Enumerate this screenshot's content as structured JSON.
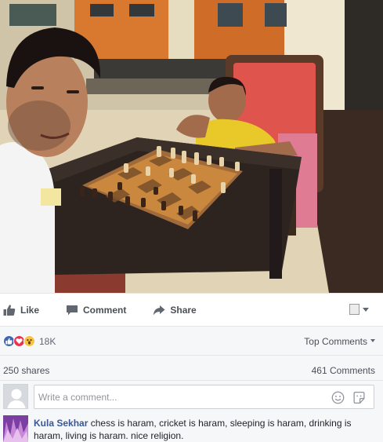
{
  "actions": {
    "like_label": "Like",
    "comment_label": "Comment",
    "share_label": "Share"
  },
  "reactions": {
    "types": [
      "like",
      "love",
      "wow"
    ],
    "count": "18K"
  },
  "sort": {
    "label": "Top Comments"
  },
  "stats": {
    "shares": "250 shares",
    "comments": "461 Comments"
  },
  "composer": {
    "placeholder": "Write a comment..."
  },
  "comment": {
    "author": "Kula Sekhar",
    "text": "chess is haram, cricket is haram, sleeping is haram, drinking is haram, living is haram. nice religion."
  },
  "colors": {
    "facebook_blue": "#4267b2",
    "link_blue": "#365899",
    "love_red": "#e9344f",
    "wow_yellow": "#f6c342",
    "panel_bg": "#f6f7f9"
  },
  "icons": {
    "like": "thumbs-up-icon",
    "comment": "speech-bubble-icon",
    "share": "share-arrow-icon",
    "emoji": "smiley-icon",
    "sticker": "sticker-icon",
    "audience": "audience-selector-icon"
  }
}
